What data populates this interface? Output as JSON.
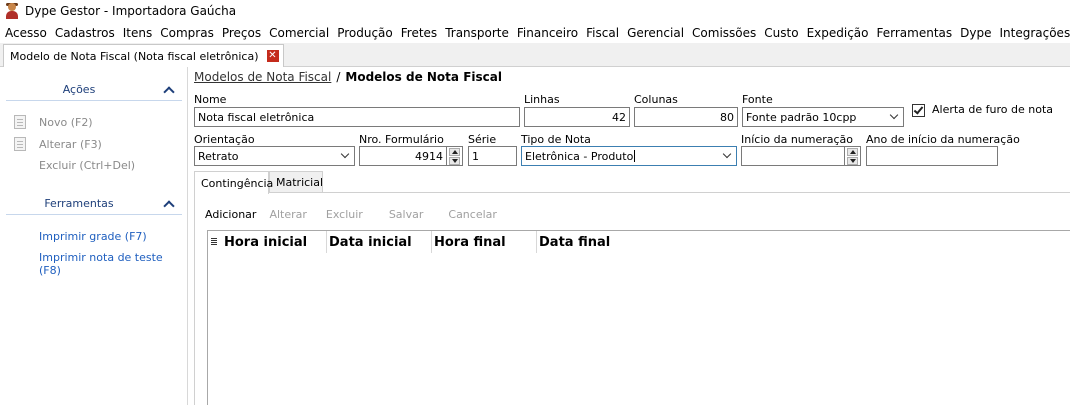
{
  "window": {
    "title": "Dype Gestor - Importadora Gaúcha"
  },
  "menu": [
    "Acesso",
    "Cadastros",
    "Itens",
    "Compras",
    "Preços",
    "Comercial",
    "Produção",
    "Fretes",
    "Transporte",
    "Financeiro",
    "Fiscal",
    "Gerencial",
    "Comissões",
    "Custo",
    "Expedição",
    "Ferramentas",
    "Dype",
    "Integrações"
  ],
  "doc_tab": {
    "label": "Modelo de Nota Fiscal (Nota fiscal eletrônica)",
    "close_glyph": "✕"
  },
  "sidebar": {
    "acoes": {
      "title": "Ações",
      "items": [
        {
          "label": "Novo (F2)",
          "icon": "new-document-icon"
        },
        {
          "label": "Alterar (F3)",
          "icon": "edit-document-icon"
        },
        {
          "label": "Excluir (Ctrl+Del)",
          "icon": ""
        }
      ]
    },
    "ferramentas": {
      "title": "Ferramentas",
      "items": [
        "Imprimir grade (F7)",
        "Imprimir nota de teste (F8)"
      ]
    }
  },
  "breadcrumb": {
    "link": "Modelos de Nota Fiscal",
    "separator": "/",
    "current": "Modelos de Nota Fiscal"
  },
  "form": {
    "nome": {
      "label": "Nome",
      "value": "Nota fiscal eletrônica"
    },
    "linhas": {
      "label": "Linhas",
      "value": "42"
    },
    "colunas": {
      "label": "Colunas",
      "value": "80"
    },
    "fonte": {
      "label": "Fonte",
      "value": "Fonte padrão 10cpp"
    },
    "alerta": {
      "label": "Alerta de furo de nota",
      "checked": true
    },
    "orientacao": {
      "label": "Orientação",
      "value": "Retrato"
    },
    "nro_formulario": {
      "label": "Nro. Formulário",
      "value": "4914"
    },
    "serie": {
      "label": "Série",
      "value": "1"
    },
    "tipo_nota": {
      "label": "Tipo de Nota",
      "value": "Eletrônica - Produto"
    },
    "inicio_numeracao": {
      "label": "Início da numeração",
      "value": ""
    },
    "ano_inicio": {
      "label": "Ano de início da numeração",
      "value": ""
    }
  },
  "tabs": [
    {
      "label": "Contingência",
      "active": true
    },
    {
      "label": "Matricial",
      "active": false
    }
  ],
  "toolbar": {
    "adicionar": "Adicionar",
    "alterar": "Alterar",
    "excluir": "Excluir",
    "salvar": "Salvar",
    "cancelar": "Cancelar"
  },
  "grid": {
    "columns": [
      "Hora inicial",
      "Data inicial",
      "Hora final",
      "Data final"
    ],
    "rows": []
  },
  "colors": {
    "accent": "#1e3f7a",
    "link": "#1f5fbf",
    "close": "#c42b1c",
    "focus_border": "#3c7fb1"
  }
}
